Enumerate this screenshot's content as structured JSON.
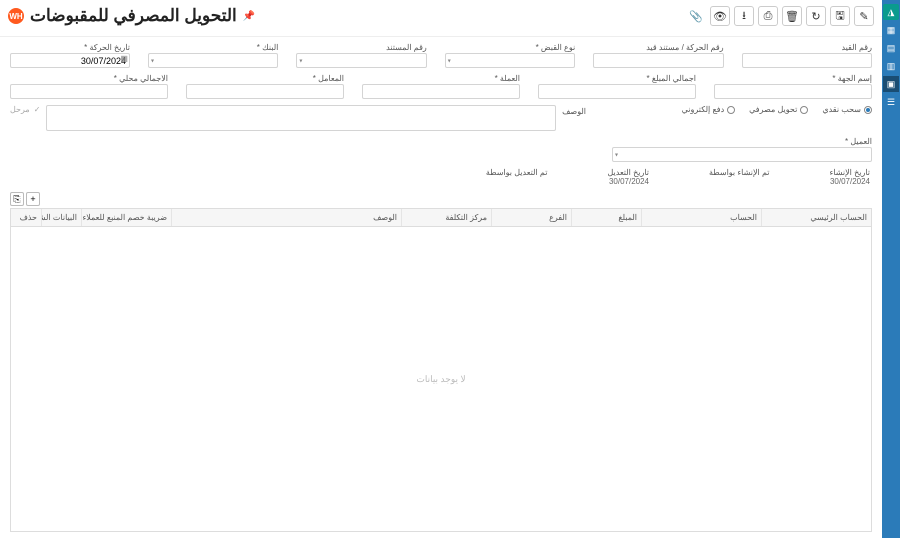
{
  "nav": {
    "items": [
      {
        "name": "logo",
        "glyph": "◮"
      },
      {
        "name": "module-1",
        "glyph": "▦"
      },
      {
        "name": "module-2",
        "glyph": "▤"
      },
      {
        "name": "module-3",
        "glyph": "▥"
      },
      {
        "name": "module-4",
        "glyph": "▣",
        "active": true
      },
      {
        "name": "module-5",
        "glyph": "☰"
      }
    ]
  },
  "header": {
    "title": "التحويل المصرفي للمقبوضات",
    "logo_text": "WH",
    "toolbar": {
      "edit": "✎",
      "save": "🖫",
      "refresh": "↻",
      "delete": "🗑",
      "print": "⎙",
      "download": "⭳",
      "view": "👁",
      "attach": "📎"
    }
  },
  "form": {
    "row1": {
      "entry_no": {
        "label": "رقم القيد",
        "value": ""
      },
      "trans_doc_no": {
        "label": "رقم الحركة / مستند قيد",
        "value": ""
      },
      "check_type": {
        "label": "نوع القبض",
        "value": ""
      },
      "document_no": {
        "label": "رقم المستند",
        "value": ""
      },
      "bank": {
        "label": "البنك",
        "value": ""
      },
      "trans_date": {
        "label": "تاريخ الحركة",
        "value": "30/07/2024"
      }
    },
    "row2": {
      "party_name": {
        "label": "إسم الجهة",
        "value": ""
      },
      "total_amount": {
        "label": "اجمالي المبلغ",
        "value": ""
      },
      "currency": {
        "label": "العملة",
        "value": ""
      },
      "factor": {
        "label": "المعامل",
        "value": ""
      },
      "local_total": {
        "label": "الاجمالي محلي",
        "value": ""
      }
    },
    "desc": {
      "label": "الوصف",
      "value": ""
    },
    "payment_type": {
      "options": [
        {
          "key": "cash",
          "label": "سحب نقدي",
          "checked": true
        },
        {
          "key": "bank",
          "label": "تحويل مصرفي",
          "checked": false
        },
        {
          "key": "epay",
          "label": "دفع إلكتروني",
          "checked": false
        }
      ]
    },
    "locked_label": "مرحل",
    "customer": {
      "label": "العميل",
      "value": ""
    }
  },
  "meta": {
    "created_date": {
      "label": "تاريخ الإنشاء",
      "value": "30/07/2024"
    },
    "created_by": {
      "label": "تم الإنشاء بواسطة",
      "value": ""
    },
    "modified_date": {
      "label": "تاريخ التعديل",
      "value": "30/07/2024"
    },
    "modified_by": {
      "label": "تم التعديل بواسطة",
      "value": ""
    }
  },
  "table": {
    "add_btn": "+",
    "export_btn": "⎘",
    "columns": {
      "main_account": "الحساب الرئيسي",
      "account": "الحساب",
      "amount": "المبلغ",
      "branch": "الفرع",
      "cost_center": "مركز التكلفة",
      "description": "الوصف",
      "sales_tax": "ضريبة خصم المنبع للعملاء",
      "extra": "البيانات الشرطية",
      "delete": "حذف"
    },
    "empty_text": "لا يوجد بيانات"
  }
}
